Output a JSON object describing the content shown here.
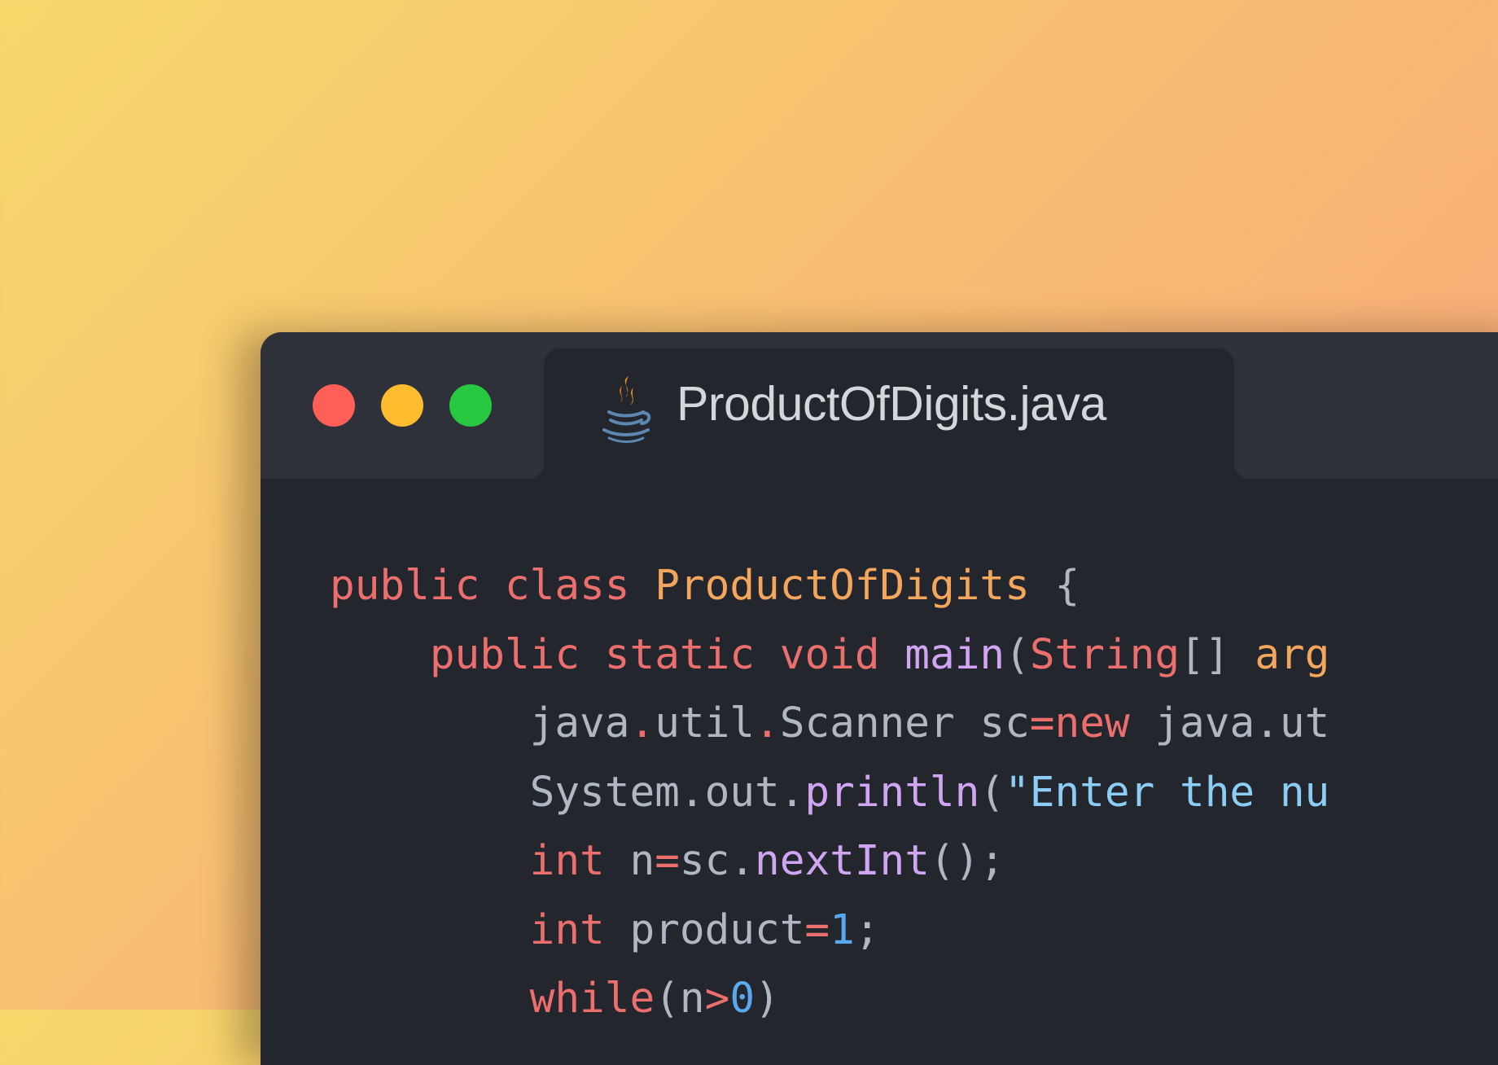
{
  "window": {
    "controls": [
      {
        "name": "close",
        "color": "#ff5f57"
      },
      {
        "name": "minimize",
        "color": "#febc2e"
      },
      {
        "name": "maximize",
        "color": "#28c840"
      }
    ],
    "tab": {
      "icon": "java-coffee-cup-icon",
      "title": "ProductOfDigits.java"
    }
  },
  "colors": {
    "background_gradient": [
      "#f6d86a",
      "#faa07c"
    ],
    "window_background": "#23262d",
    "titlebar_background": "#2e3139",
    "keyword": "#ec6f6e",
    "class": "#f3a65c",
    "method": "#d0a6f2",
    "string": "#8ccdf5",
    "number": "#5aa8f0",
    "plain": "#b0b7c3"
  },
  "code": {
    "language": "Java",
    "lines": [
      {
        "indent": 0,
        "tokens": [
          {
            "t": "keyword",
            "v": "public"
          },
          {
            "t": "plain",
            "v": " "
          },
          {
            "t": "keyword",
            "v": "class"
          },
          {
            "t": "plain",
            "v": " "
          },
          {
            "t": "class",
            "v": "ProductOfDigits"
          },
          {
            "t": "plain",
            "v": " {"
          }
        ]
      },
      {
        "indent": 4,
        "tokens": [
          {
            "t": "keyword",
            "v": "public"
          },
          {
            "t": "plain",
            "v": " "
          },
          {
            "t": "keyword",
            "v": "static"
          },
          {
            "t": "plain",
            "v": " "
          },
          {
            "t": "keyword",
            "v": "void"
          },
          {
            "t": "plain",
            "v": " "
          },
          {
            "t": "method",
            "v": "main"
          },
          {
            "t": "plain",
            "v": "("
          },
          {
            "t": "keyword",
            "v": "String"
          },
          {
            "t": "plain",
            "v": "[] "
          },
          {
            "t": "class",
            "v": "arg"
          }
        ]
      },
      {
        "indent": 8,
        "tokens": [
          {
            "t": "plain",
            "v": "java"
          },
          {
            "t": "operator",
            "v": "."
          },
          {
            "t": "plain",
            "v": "util"
          },
          {
            "t": "operator",
            "v": "."
          },
          {
            "t": "plain",
            "v": "Scanner sc"
          },
          {
            "t": "operator",
            "v": "="
          },
          {
            "t": "keyword",
            "v": "new"
          },
          {
            "t": "plain",
            "v": " java.ut"
          }
        ]
      },
      {
        "indent": 8,
        "tokens": [
          {
            "t": "plain",
            "v": "System.out."
          },
          {
            "t": "method",
            "v": "println"
          },
          {
            "t": "plain",
            "v": "("
          },
          {
            "t": "string",
            "v": "\"Enter the nu"
          }
        ]
      },
      {
        "indent": 8,
        "tokens": [
          {
            "t": "keyword",
            "v": "int"
          },
          {
            "t": "plain",
            "v": " n"
          },
          {
            "t": "operator",
            "v": "="
          },
          {
            "t": "plain",
            "v": "sc."
          },
          {
            "t": "method",
            "v": "nextInt"
          },
          {
            "t": "plain",
            "v": "();"
          }
        ]
      },
      {
        "indent": 8,
        "tokens": [
          {
            "t": "keyword",
            "v": "int"
          },
          {
            "t": "plain",
            "v": " product"
          },
          {
            "t": "operator",
            "v": "="
          },
          {
            "t": "number",
            "v": "1"
          },
          {
            "t": "plain",
            "v": ";"
          }
        ]
      },
      {
        "indent": 8,
        "tokens": [
          {
            "t": "keyword",
            "v": "while"
          },
          {
            "t": "plain",
            "v": "(n"
          },
          {
            "t": "operator",
            "v": ">"
          },
          {
            "t": "number",
            "v": "0"
          },
          {
            "t": "plain",
            "v": ")"
          }
        ]
      }
    ]
  }
}
